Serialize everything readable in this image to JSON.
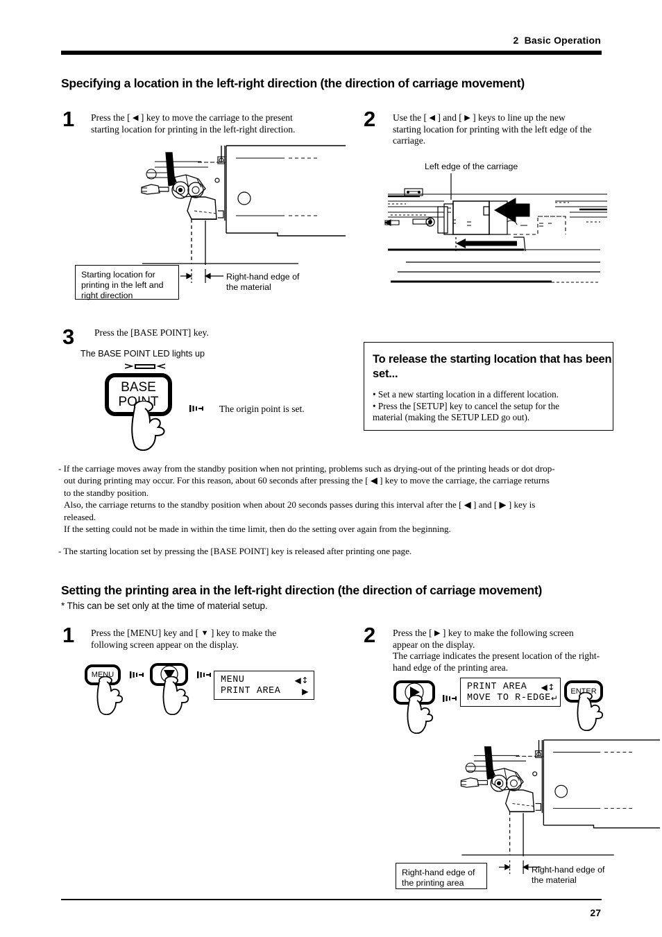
{
  "header": {
    "chapter_number": "2",
    "chapter_title": "Basic Operation"
  },
  "footer": {
    "page_number": "27"
  },
  "sections": [
    {
      "heading": "Specifying a location in the left-right direction (the direction of carriage movement)",
      "steps": [
        {
          "number": "1",
          "line1_pre": "Press the [ ",
          "line1_icon": "◀",
          "line1_post": " ] key to move the carriage to the present",
          "line2": "starting location for printing in the left-right direction."
        },
        {
          "number": "2",
          "line1_pre": "Use the [ ",
          "line1_icon": "◀",
          "line1_mid": " ] and [ ",
          "line1_icon2": "▶",
          "line1_post": " ] keys to line up the new",
          "line2": "starting location for printing with the left edge of the",
          "line3": "carriage."
        },
        {
          "number": "3",
          "line1": "Press the [BASE POINT] key."
        }
      ],
      "captions": {
        "starting_location": "Starting location for\nprinting in the left and\nright direction",
        "right_hand_edge_material": "Right-hand edge of\nthe material",
        "left_edge_carriage": "Left edge of the carriage",
        "led_lights_up": "The BASE POINT LED lights up",
        "origin_point_set": "The origin point is set."
      },
      "keys": {
        "base_point_line1": "BASE",
        "base_point_line2": "POINT"
      }
    },
    {
      "heading": "Setting the printing area in the left-right direction (the direction of carriage movement)",
      "subheading": "* This can be set only at the time of material setup.",
      "steps": [
        {
          "number": "1",
          "line1_pre": "Press the [MENU] key and [ ",
          "line1_icon": "▼",
          "line1_post": " ] key to make the",
          "line2": "following screen appear on the display."
        },
        {
          "number": "2",
          "line1_pre": "Press the [ ",
          "line1_icon": "▶",
          "line1_post": " ] key to make the following screen",
          "line2": "appear on the display.",
          "line3": "The carriage indicates the present location of the right-",
          "line4": "hand edge of the printing area."
        }
      ],
      "keys": {
        "menu_label": "MENU",
        "enter_label": "ENTER"
      },
      "displays": [
        {
          "row1_text": "MENU",
          "row1_indicator": "◀↕",
          "row2_text": "PRINT AREA",
          "row2_indicator": "▶"
        },
        {
          "row1_text": "PRINT AREA",
          "row1_indicator": "◀↕",
          "row2_text": "MOVE TO R-EDGE",
          "row2_indicator": "↵"
        }
      ],
      "captions": {
        "right_hand_edge_printing_area": "Right-hand edge of\nthe printing area",
        "right_hand_edge_material": "Right-hand edge of\nthe material"
      }
    }
  ],
  "callout": {
    "title": "To release the starting location that has been set...",
    "items": [
      "• Set a new starting location in a different location.",
      "• Press the [SETUP] key to cancel the setup for the",
      "   material (making the SETUP LED go out)."
    ]
  },
  "notes": [
    {
      "lines": [
        "- If the carriage moves away from the standby position when not printing, problems such as drying-out of the printing heads or dot drop-",
        "out during printing may occur.  For this reason, about 60 seconds after pressing the [ ◀ ] key to move the carriage, the carriage returns",
        "to the standby position.",
        "Also, the carriage returns to the standby position when about 20 seconds passes during this interval after the [ ◀ ] and [ ▶ ] key is",
        "released.",
        "If the setting could not be made in within the time limit, then do the setting over again from the beginning."
      ]
    },
    {
      "lines": [
        "- The starting location set by pressing the [BASE POINT] key is released after printing one page."
      ]
    }
  ]
}
